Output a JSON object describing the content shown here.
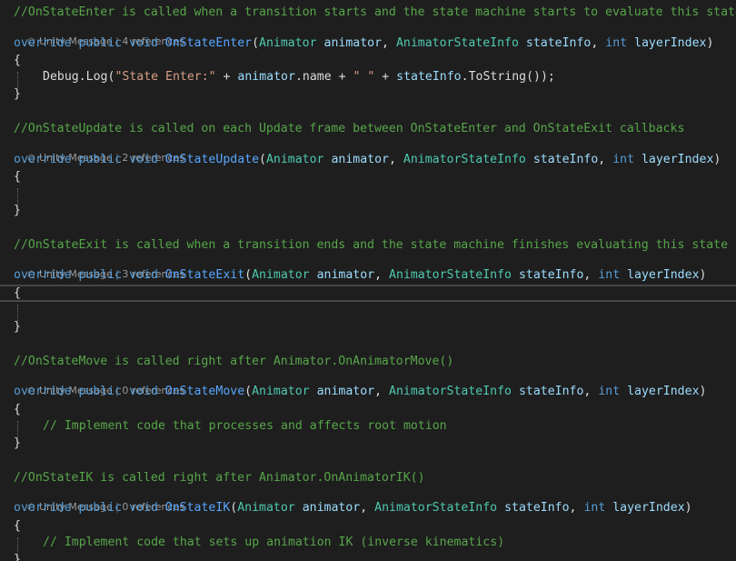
{
  "colors": {
    "background": "#1e1e1e",
    "comment": "#57a64a",
    "keyword": "#569cd6",
    "type": "#4ec9b0",
    "method": "#57a6ff",
    "parameter": "#9cdcfe",
    "string": "#d69d85"
  },
  "icons": {
    "unity_message": "unity-cube-icon"
  },
  "methods": [
    {
      "comment": "//OnStateEnter is called when a transition starts and the state machine starts to evaluate this state",
      "lens_label": "Unity Message",
      "lens_sep": "|",
      "lens_refs": "4 references",
      "kw_override": "override",
      "kw_public": "public",
      "kw_void": "void",
      "name": "OnStateEnter",
      "paren_open": "(",
      "type1": "Animator",
      "param1": "animator",
      "comma1": ",",
      "type2": "AnimatorStateInfo",
      "param2": "stateInfo",
      "comma2": ",",
      "type3": "int",
      "param3": "layerIndex",
      "paren_close": ")",
      "brace_open": "{",
      "body": {
        "debug": "Debug",
        "dot1": ".",
        "log": "Log",
        "p_open": "(",
        "str1": "\"State Enter:\"",
        "plus1": " + ",
        "obj": "animator",
        "dot2": ".",
        "prop": "name",
        "plus2": " + ",
        "str2": "\" \"",
        "plus3": " + ",
        "obj2": "stateInfo",
        "dot3": ".",
        "tostring": "ToString",
        "call_end": "());"
      },
      "brace_close": "}"
    },
    {
      "comment": "//OnStateUpdate is called on each Update frame between OnStateEnter and OnStateExit callbacks",
      "lens_label": "Unity Message",
      "lens_sep": "|",
      "lens_refs": "2 references",
      "kw_override": "override",
      "kw_public": "public",
      "kw_void": "void",
      "name": "OnStateUpdate",
      "paren_open": "(",
      "type1": "Animator",
      "param1": "animator",
      "comma1": ",",
      "type2": "AnimatorStateInfo",
      "param2": "stateInfo",
      "comma2": ",",
      "type3": "int",
      "param3": "layerIndex",
      "paren_close": ")",
      "brace_open": "{",
      "brace_close": "}"
    },
    {
      "comment": "//OnStateExit is called when a transition ends and the state machine finishes evaluating this state",
      "lens_label": "Unity Message",
      "lens_sep": "|",
      "lens_refs": "3 references",
      "kw_override": "override",
      "kw_public": "public",
      "kw_void": "void",
      "name": "OnStateExit",
      "paren_open": "(",
      "type1": "Animator",
      "param1": "animator",
      "comma1": ",",
      "type2": "AnimatorStateInfo",
      "param2": "stateInfo",
      "comma2": ",",
      "type3": "int",
      "param3": "layerIndex",
      "paren_close": ")",
      "brace_open": "{",
      "brace_close": "}"
    },
    {
      "comment": "//OnStateMove is called right after Animator.OnAnimatorMove()",
      "lens_label": "Unity Message",
      "lens_sep": "|",
      "lens_refs": "0 references",
      "kw_override": "override",
      "kw_public": "public",
      "kw_void": "void",
      "name": "OnStateMove",
      "paren_open": "(",
      "type1": "Animator",
      "param1": "animator",
      "comma1": ",",
      "type2": "AnimatorStateInfo",
      "param2": "stateInfo",
      "comma2": ",",
      "type3": "int",
      "param3": "layerIndex",
      "paren_close": ")",
      "brace_open": "{",
      "inner_comment": "// Implement code that processes and affects root motion",
      "brace_close": "}"
    },
    {
      "comment": "//OnStateIK is called right after Animator.OnAnimatorIK()",
      "lens_label": "Unity Message",
      "lens_sep": "|",
      "lens_refs": "0 references",
      "kw_override": "override",
      "kw_public": "public",
      "kw_void": "void",
      "name": "OnStateIK",
      "paren_open": "(",
      "type1": "Animator",
      "param1": "animator",
      "comma1": ",",
      "type2": "AnimatorStateInfo",
      "param2": "stateInfo",
      "comma2": ",",
      "type3": "int",
      "param3": "layerIndex",
      "paren_close": ")",
      "brace_open": "{",
      "inner_comment": "// Implement code that sets up animation IK (inverse kinematics)",
      "brace_close": "}"
    }
  ]
}
